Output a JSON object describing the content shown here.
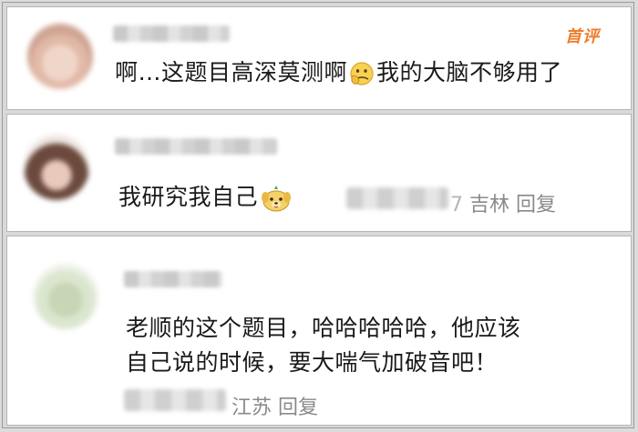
{
  "comments": [
    {
      "badge": "首评",
      "text_before": "啊…这题目高深莫测啊",
      "emoji": "thinking-emoji",
      "text_after": "我的大脑不够用了"
    },
    {
      "text_before": "我研究我自己",
      "emoji": "dog-emoji",
      "meta_suffix": "7",
      "location": "吉林",
      "reply_label": "回复"
    },
    {
      "line1": "老顺的这个题目，哈哈哈哈哈，他应该",
      "line2": "自己说的时候，要大喘气加破音吧！",
      "location": "江苏",
      "reply_label": "回复"
    }
  ],
  "colors": {
    "badge": "#ee7d2a",
    "meta": "#8a8a8a",
    "text": "#1a1a1a"
  }
}
